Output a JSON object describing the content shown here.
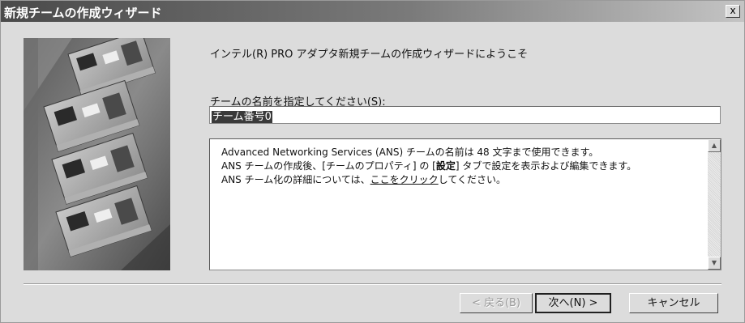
{
  "window": {
    "title": "新規チームの作成ウィザード",
    "close_label": "x"
  },
  "main": {
    "welcome_text": "インテル(R) PRO アダプタ新規チームの作成ウィザードにようこそ",
    "name_label_prefix": "チームの名前を指定してください(",
    "name_label_key": "S",
    "name_label_suffix": "):",
    "name_value": "チーム番号0"
  },
  "info": {
    "line1": "Advanced Networking Services (ANS) チームの名前は 48 文字まで使用できます。",
    "line2_a": "ANS チームの作成後、[チームのプロパティ] の [",
    "line2_bold": "設定",
    "line2_b": "] タブで設定を表示および編集できます。",
    "line3_a": "ANS チーム化の詳細については、",
    "line3_link": "ここをクリック",
    "line3_b": "してください。"
  },
  "buttons": {
    "back": "< 戻る(B)",
    "next": "次へ(N) >",
    "cancel": "キャンセル"
  },
  "image": {
    "description_icon": "network-adapter-cards-image"
  },
  "colors": {
    "title_dark": "#4a4a4a",
    "title_light": "#c4c4c4",
    "window_bg": "#dcdcdc"
  }
}
